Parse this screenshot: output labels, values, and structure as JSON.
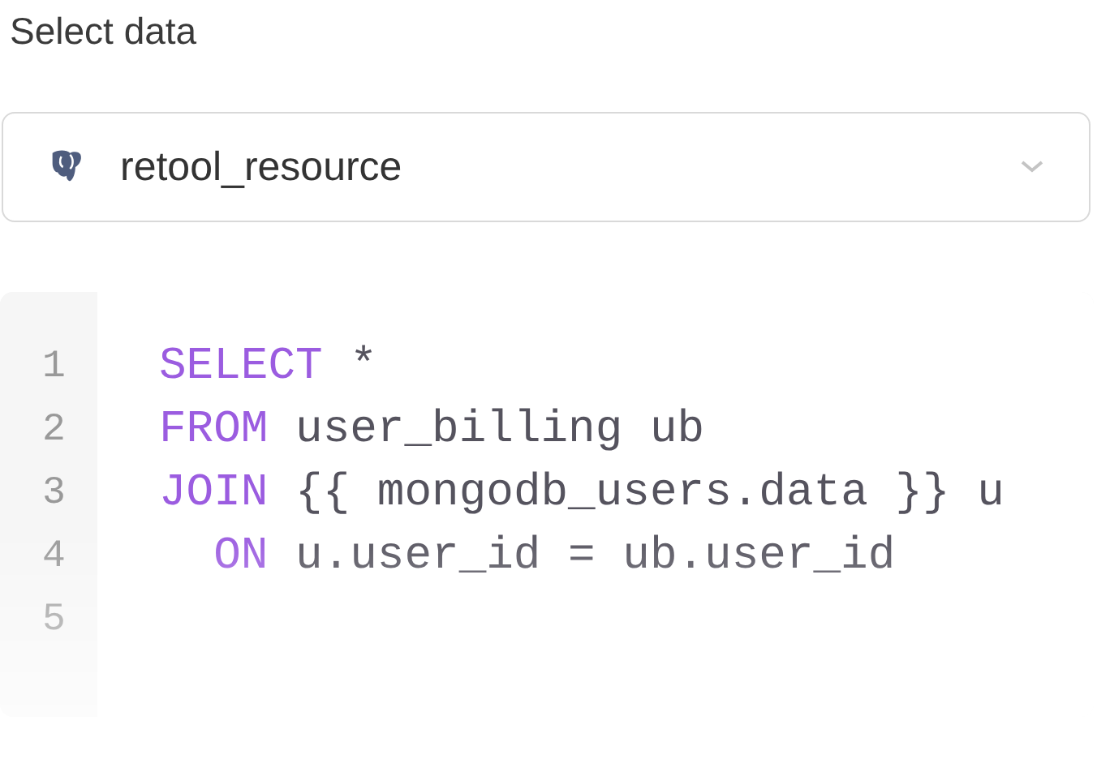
{
  "title": "Select data",
  "resource_select": {
    "value": "retool_resource"
  },
  "editor": {
    "lines": [
      {
        "number": "1",
        "tokens": [
          {
            "kind": "keyword",
            "text": "SELECT"
          },
          {
            "kind": "plain",
            "text": " *"
          }
        ]
      },
      {
        "number": "2",
        "tokens": [
          {
            "kind": "keyword",
            "text": "FROM"
          },
          {
            "kind": "plain",
            "text": " user_billing ub"
          }
        ]
      },
      {
        "number": "3",
        "tokens": [
          {
            "kind": "keyword",
            "text": "JOIN"
          },
          {
            "kind": "plain",
            "text": " {{ mongodb_users.data }} u"
          }
        ]
      },
      {
        "number": "4",
        "indented": true,
        "tokens": [
          {
            "kind": "keyword",
            "text": "ON"
          },
          {
            "kind": "plain",
            "text": " u.user_id = ub.user_id"
          }
        ]
      },
      {
        "number": "5"
      }
    ]
  }
}
